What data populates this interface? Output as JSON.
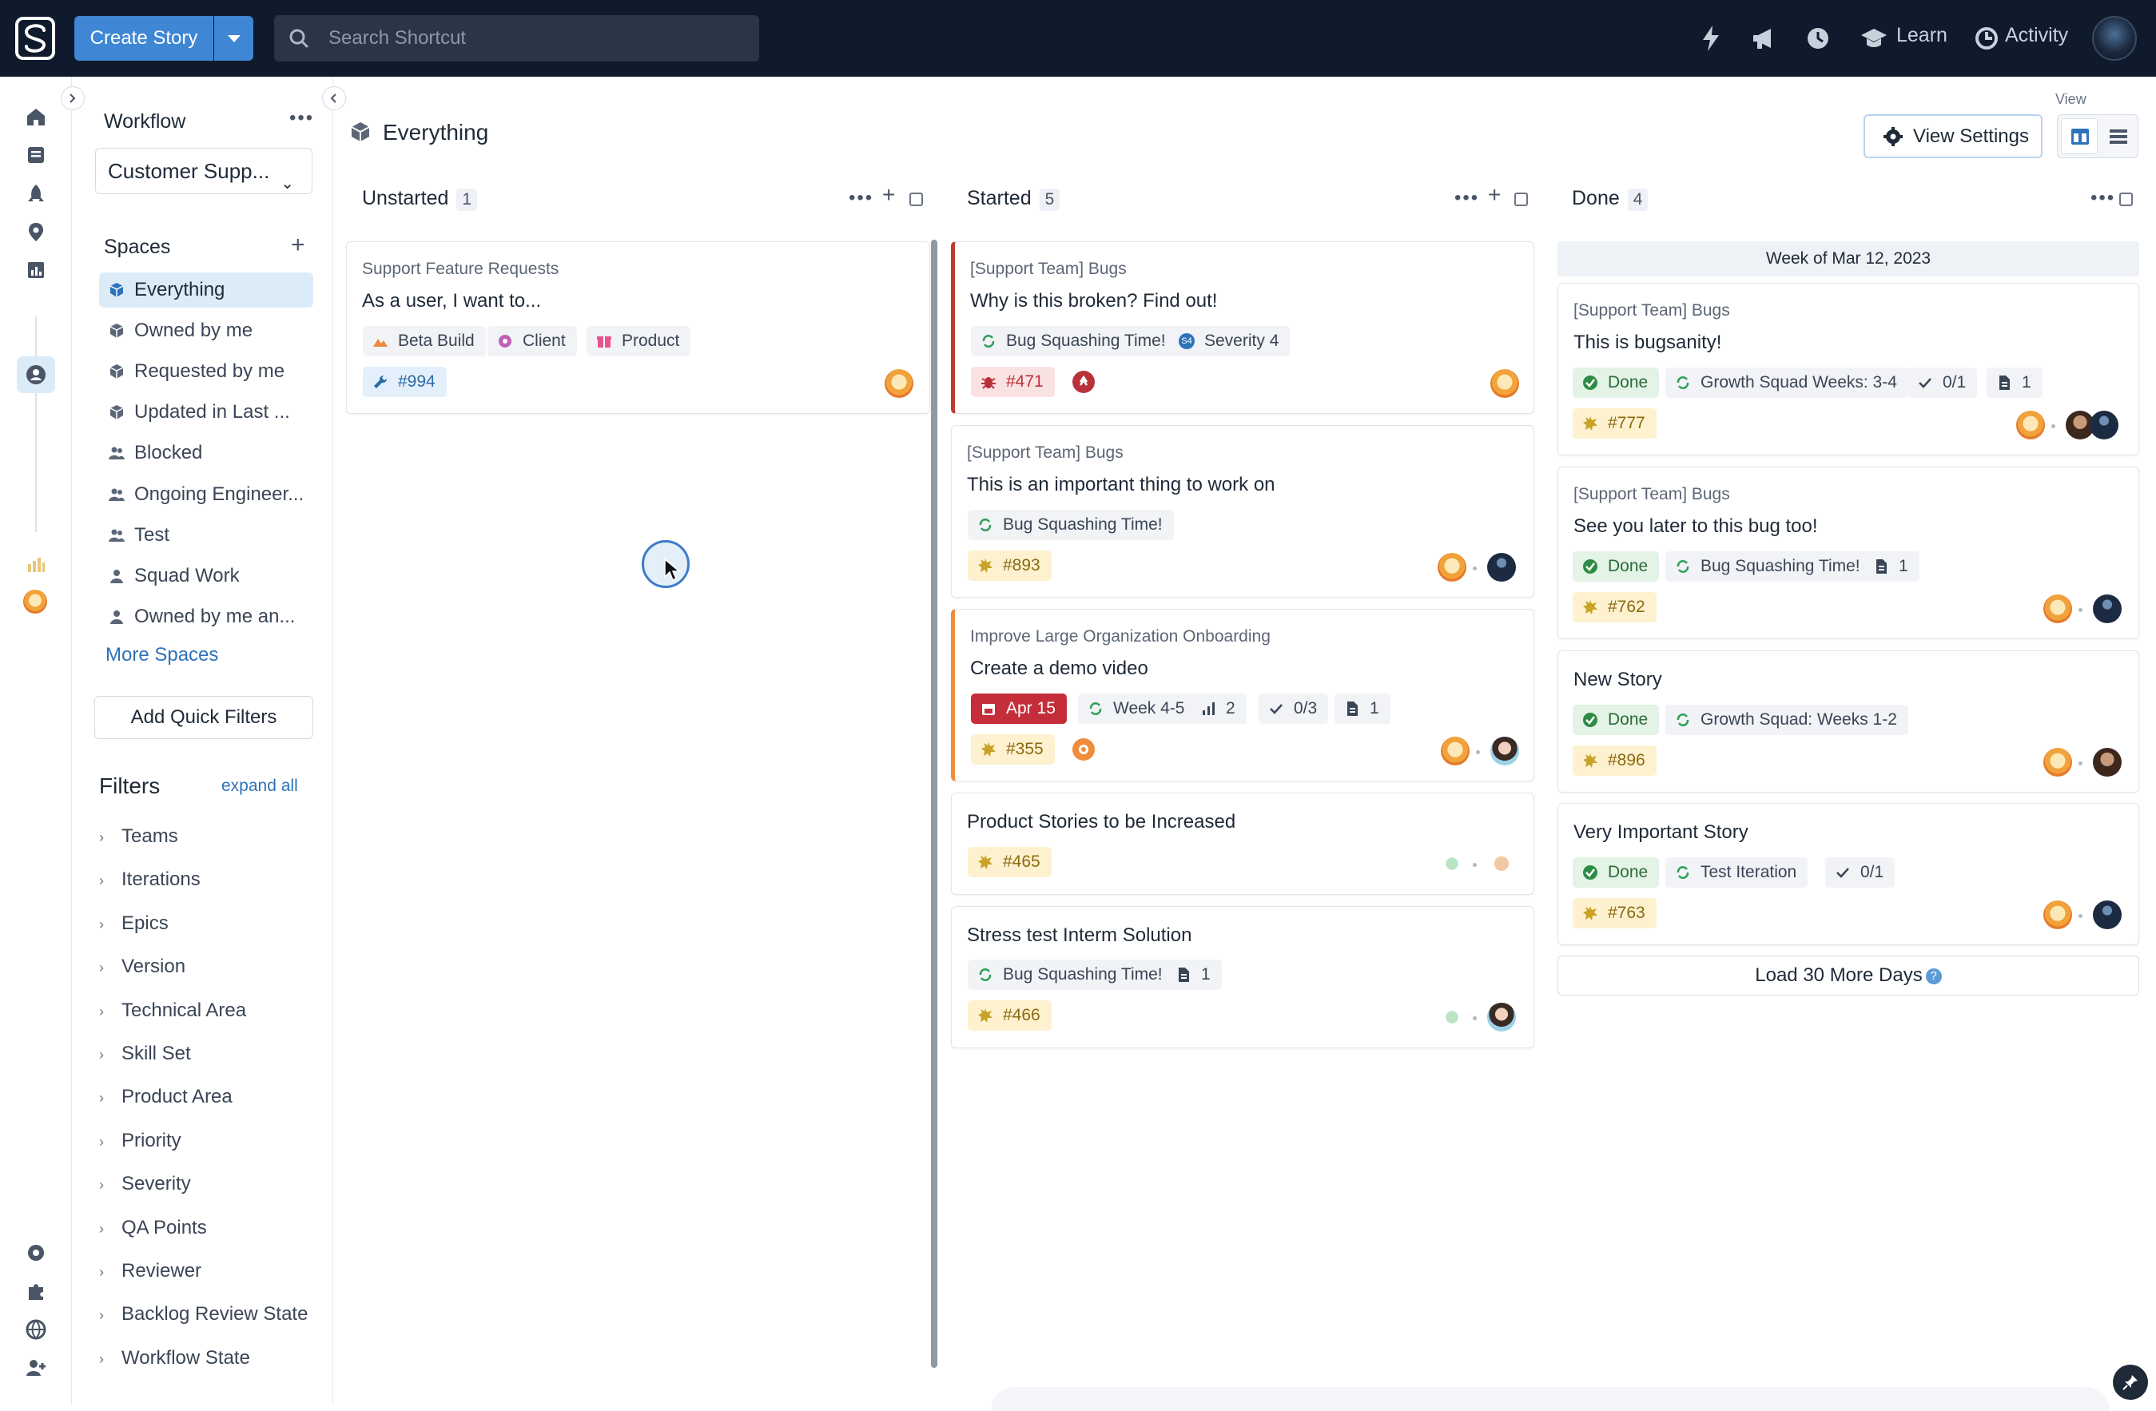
{
  "topbar": {
    "create_label": "Create Story",
    "search_placeholder": "Search Shortcut",
    "learn": "Learn",
    "activity": "Activity"
  },
  "sidebar": {
    "workflow_title": "Workflow",
    "workflow_select": "Customer Supp...",
    "spaces_title": "Spaces",
    "spaces": [
      {
        "label": "Everything",
        "icon": "cube-icon"
      },
      {
        "label": "Owned by me",
        "icon": "cube-icon"
      },
      {
        "label": "Requested by me",
        "icon": "cube-icon"
      },
      {
        "label": "Updated in Last ...",
        "icon": "cube-icon"
      },
      {
        "label": "Blocked",
        "icon": "users-icon"
      },
      {
        "label": "Ongoing Engineer...",
        "icon": "users-icon"
      },
      {
        "label": "Test",
        "icon": "users-icon"
      },
      {
        "label": "Squad Work",
        "icon": "user-icon"
      },
      {
        "label": "Owned by me an...",
        "icon": "user-icon"
      }
    ],
    "more_spaces": "More Spaces",
    "add_quick_filters": "Add Quick Filters",
    "filters_title": "Filters",
    "expand_all": "expand all",
    "filters": [
      "Teams",
      "Iterations",
      "Epics",
      "Version",
      "Technical Area",
      "Skill Set",
      "Product Area",
      "Priority",
      "Severity",
      "QA Points",
      "Reviewer",
      "Backlog Review State",
      "Workflow State"
    ]
  },
  "main": {
    "title": "Everything",
    "view_settings": "View Settings",
    "view_label": "View",
    "columns": {
      "unstarted": {
        "name": "Unstarted",
        "count": "1"
      },
      "started": {
        "name": "Started",
        "count": "5"
      },
      "done": {
        "name": "Done",
        "count": "4"
      }
    },
    "week_header": "Week of Mar 12, 2023",
    "load_more": "Load 30 More Days"
  },
  "cards": {
    "u1": {
      "category": "Support Feature Requests",
      "title": "As a user, I want to...",
      "chips": [
        "Beta Build",
        "Client",
        "Product"
      ],
      "id": "#994"
    },
    "s1": {
      "category": "[Support Team] Bugs",
      "title": "Why is this broken? Find out!",
      "iteration": "Bug Squashing Time!",
      "severity": "Severity 4",
      "severity_badge": "S4",
      "id": "#471"
    },
    "s2": {
      "category": "[Support Team] Bugs",
      "title": "This is an important thing to work on",
      "iteration": "Bug Squashing Time!",
      "id": "#893"
    },
    "s3": {
      "category": "Improve Large Organization Onboarding",
      "title": "Create a demo video",
      "date": "Apr 15",
      "iteration": "Week 4-5",
      "estimate": "2",
      "tasks": "0/3",
      "docs": "1",
      "id": "#355"
    },
    "s4": {
      "title": "Product Stories to be Increased",
      "id": "#465"
    },
    "s5": {
      "title": "Stress test Interm Solution",
      "iteration": "Bug Squashing Time!",
      "docs": "1",
      "id": "#466"
    },
    "d1": {
      "category": "[Support Team] Bugs",
      "title": "This is bugsanity!",
      "state": "Done",
      "iteration": "Growth Squad Weeks: 3-4",
      "tasks": "0/1",
      "docs": "1",
      "id": "#777"
    },
    "d2": {
      "category": "[Support Team] Bugs",
      "title": "See you later to this bug too!",
      "state": "Done",
      "iteration": "Bug Squashing Time!",
      "docs": "1",
      "id": "#762"
    },
    "d3": {
      "title": "New Story",
      "state": "Done",
      "iteration": "Growth Squad: Weeks 1-2",
      "id": "#896"
    },
    "d4": {
      "title": "Very Important Story",
      "state": "Done",
      "iteration": "Test Iteration",
      "tasks": "0/1",
      "id": "#763"
    }
  },
  "colors": {
    "topbar": "#0f1b2d",
    "primary": "#3f86d4",
    "id_chip": "#fdf1cf",
    "red_border": "#c0392b",
    "orange_border": "#f08c3a",
    "done_green": "#2e8b46"
  }
}
